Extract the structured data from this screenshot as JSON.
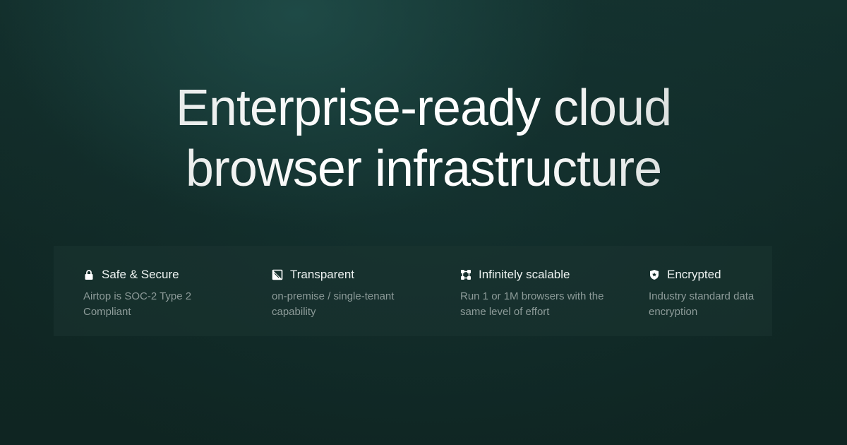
{
  "headline": {
    "line1": "Enterprise-ready cloud",
    "line2": "browser infrastructure"
  },
  "features": [
    {
      "icon": "lock-icon",
      "title": "Safe & Secure",
      "description": "Airtop is SOC-2 Type 2 Compliant"
    },
    {
      "icon": "transparent-icon",
      "title": "Transparent",
      "description": "on-premise / single-tenant capability"
    },
    {
      "icon": "scale-nodes-icon",
      "title": "Infinitely scalable",
      "description": "Run 1 or 1M browsers with the same level of effort"
    },
    {
      "icon": "shield-star-icon",
      "title": "Encrypted",
      "description": "Industry standard data encryption"
    }
  ],
  "colors": {
    "background": "#0f2724",
    "headline": "#e9efee",
    "feature_title": "#eef3f2",
    "feature_description": "#8d9b99"
  }
}
